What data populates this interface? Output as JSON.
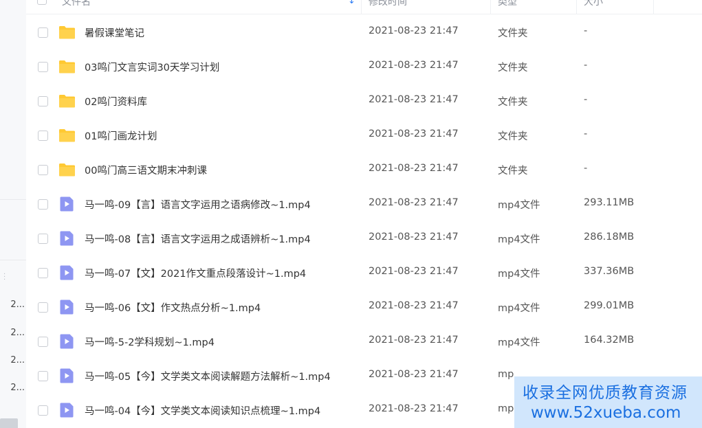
{
  "sidebar": {
    "items": [
      "2...",
      "2...",
      "2...",
      "2..."
    ]
  },
  "table": {
    "columns": {
      "name": "文件名",
      "modified": "修改时间",
      "type": "类型",
      "size": "大小"
    },
    "rows": [
      {
        "name": "暑假课堂笔记",
        "modified": "2021-08-23 21:47",
        "type": "文件夹",
        "size": "-",
        "icon": "folder-icon"
      },
      {
        "name": "03鸣门文言实词30天学习计划",
        "modified": "2021-08-23 21:47",
        "type": "文件夹",
        "size": "-",
        "icon": "folder-icon"
      },
      {
        "name": "02鸣门资料库",
        "modified": "2021-08-23 21:47",
        "type": "文件夹",
        "size": "-",
        "icon": "folder-icon"
      },
      {
        "name": "01鸣门画龙计划",
        "modified": "2021-08-23 21:47",
        "type": "文件夹",
        "size": "-",
        "icon": "folder-icon"
      },
      {
        "name": "00鸣门高三语文期末冲刺课",
        "modified": "2021-08-23 21:47",
        "type": "文件夹",
        "size": "-",
        "icon": "folder-icon"
      },
      {
        "name": "马一鸣-09【言】语言文字运用之语病修改~1.mp4",
        "modified": "2021-08-23 21:47",
        "type": "mp4文件",
        "size": "293.11MB",
        "icon": "video-file-icon"
      },
      {
        "name": "马一鸣-08【言】语言文字运用之成语辨析~1.mp4",
        "modified": "2021-08-23 21:47",
        "type": "mp4文件",
        "size": "286.18MB",
        "icon": "video-file-icon"
      },
      {
        "name": "马一鸣-07【文】2021作文重点段落设计~1.mp4",
        "modified": "2021-08-23 21:47",
        "type": "mp4文件",
        "size": "337.36MB",
        "icon": "video-file-icon"
      },
      {
        "name": "马一鸣-06【文】作文热点分析~1.mp4",
        "modified": "2021-08-23 21:47",
        "type": "mp4文件",
        "size": "299.01MB",
        "icon": "video-file-icon"
      },
      {
        "name": "马一鸣-5-2学科规划~1.mp4",
        "modified": "2021-08-23 21:47",
        "type": "mp4文件",
        "size": "164.32MB",
        "icon": "video-file-icon"
      },
      {
        "name": "马一鸣-05【今】文学类文本阅读解题方法解析~1.mp4",
        "modified": "2021-08-23 21:47",
        "type": "mp",
        "size": "",
        "icon": "video-file-icon"
      },
      {
        "name": "马一鸣-04【今】文学类文本阅读知识点梳理~1.mp4",
        "modified": "2021-08-23 21:47",
        "type": "mp",
        "size": "",
        "icon": "video-file-icon"
      }
    ]
  },
  "watermark": {
    "line1": "收录全网优质教育资源",
    "line2": "www.52xueba.com"
  },
  "colors": {
    "folder": "#ffc933",
    "video": "#8e96f2",
    "accent": "#2b7bf5"
  }
}
